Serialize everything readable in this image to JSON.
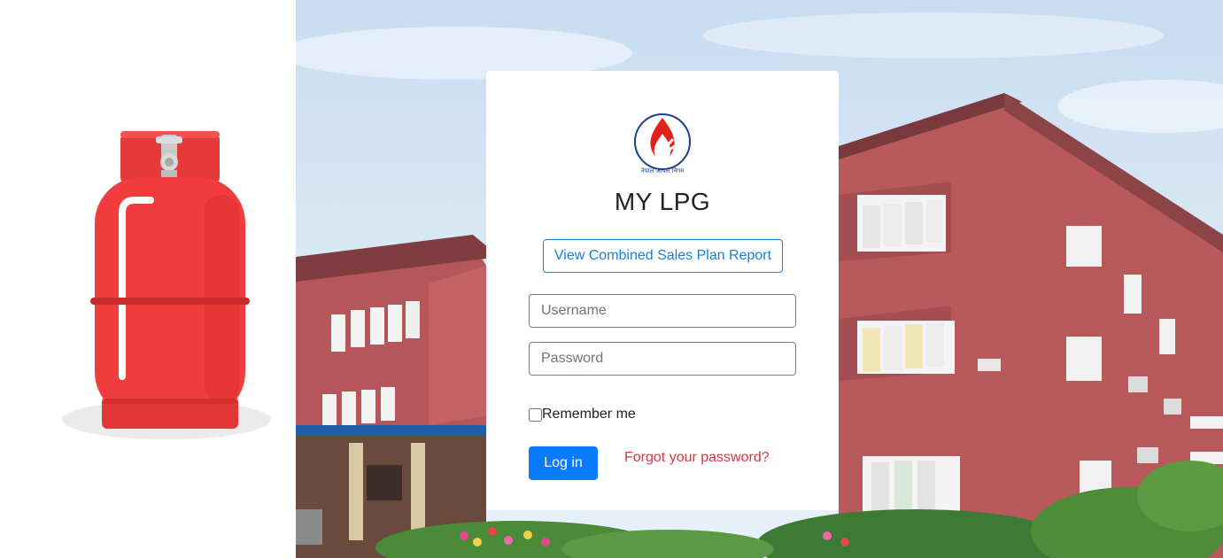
{
  "app": {
    "title": "MY LPG"
  },
  "logo": {
    "icon": "flame-logo-icon",
    "caption": "नेपाल आयल निगम",
    "color": "#e2211c",
    "ring_color": "#1d3f8f"
  },
  "report_button": {
    "label": "View Combined Sales Plan Report"
  },
  "login_form": {
    "username_placeholder": "Username",
    "password_placeholder": "Password",
    "remember_label": "Remember me",
    "remember_checked": false,
    "login_label": "Log in",
    "forgot_label": "Forgot your password?"
  },
  "colors": {
    "primary": "#0a7bff",
    "link_danger": "#dc3545",
    "outline_accent": "#1a7fd4",
    "cylinder": "#f03c3c"
  }
}
